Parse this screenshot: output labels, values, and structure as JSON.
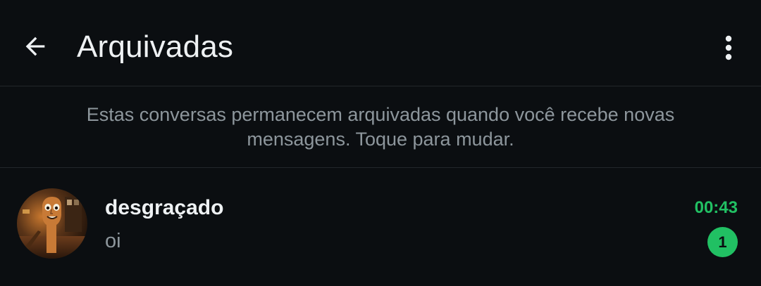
{
  "header": {
    "title": "Arquivadas",
    "back_icon": "arrow-left-icon",
    "menu_icon": "more-vertical-icon"
  },
  "info": {
    "text": "Estas conversas permanecem arquivadas quando você recebe novas mensagens. Toque para mudar."
  },
  "chats": [
    {
      "name": "desgraçado",
      "last_message": "oi",
      "time": "00:43",
      "unread_count": "1",
      "avatar_icon": "contact-avatar"
    }
  ],
  "colors": {
    "background": "#0b0e11",
    "accent": "#21c063",
    "text_primary": "#eef1f3",
    "text_secondary": "#8d969c",
    "divider": "#23272b"
  }
}
